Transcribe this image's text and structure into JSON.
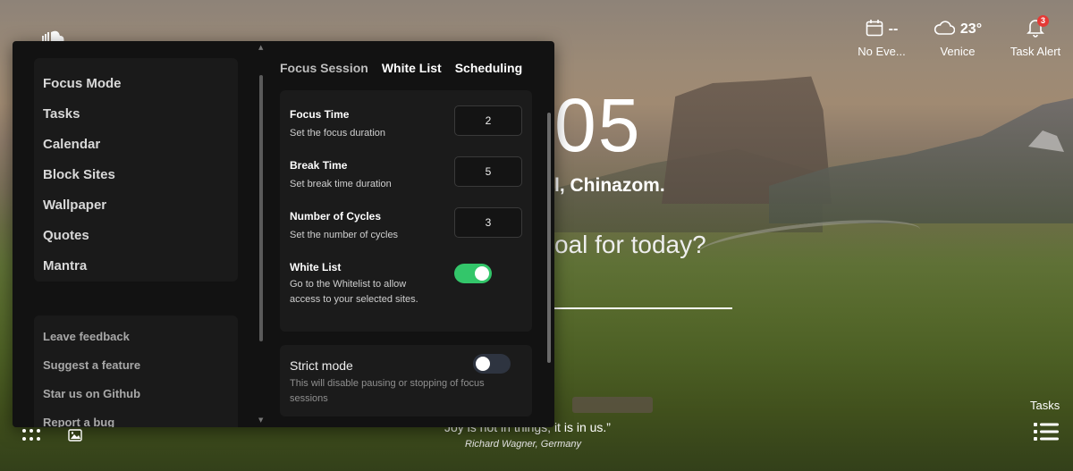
{
  "background": {
    "clock": "05",
    "greeting": "l, Chinazom.",
    "goal_question": "oal for today?",
    "quote": "Joy is not in things; it is in us.”",
    "quote_author": "Richard Wagner, Germany"
  },
  "widgets": {
    "events": {
      "value": "--",
      "label": "No Eve...",
      "icon": "calendar-icon"
    },
    "weather": {
      "value": "23°",
      "label": "Venice",
      "icon": "cloud-icon"
    },
    "task_alert": {
      "badge": "3",
      "label": "Task Alert",
      "icon": "bell-icon"
    },
    "tasks_corner": {
      "label": "Tasks",
      "icon": "list-icon"
    }
  },
  "sidebar": {
    "items": [
      {
        "label": "Focus Mode"
      },
      {
        "label": "Tasks"
      },
      {
        "label": "Calendar"
      },
      {
        "label": "Block Sites"
      },
      {
        "label": "Wallpaper"
      },
      {
        "label": "Quotes"
      },
      {
        "label": "Mantra"
      }
    ],
    "footer": [
      {
        "label": "Leave feedback"
      },
      {
        "label": "Suggest a feature"
      },
      {
        "label": "Star us on Github"
      },
      {
        "label": "Report a bug"
      }
    ]
  },
  "tabs": [
    {
      "label": "Focus Session",
      "active": false
    },
    {
      "label": "White List",
      "active": true
    },
    {
      "label": "Scheduling",
      "active": true
    }
  ],
  "settings": {
    "focus_time": {
      "title": "Focus Time",
      "desc": "Set the focus duration",
      "value": "2"
    },
    "break_time": {
      "title": "Break Time",
      "desc": "Set break time duration",
      "value": "5"
    },
    "cycles": {
      "title": "Number of Cycles",
      "desc": "Set the number of cycles",
      "value": "3"
    },
    "white_list": {
      "title": "White List",
      "desc": "Go to the Whitelist to allow access to your selected sites.",
      "enabled": true
    },
    "strict_mode": {
      "title": "Strict mode",
      "desc": "This will disable pausing or stopping of focus sessions",
      "enabled": false
    }
  },
  "colors": {
    "panel_bg": "#121212",
    "toggle_on": "#33c66a",
    "toggle_off": "#2e3440",
    "badge": "#e53935"
  }
}
